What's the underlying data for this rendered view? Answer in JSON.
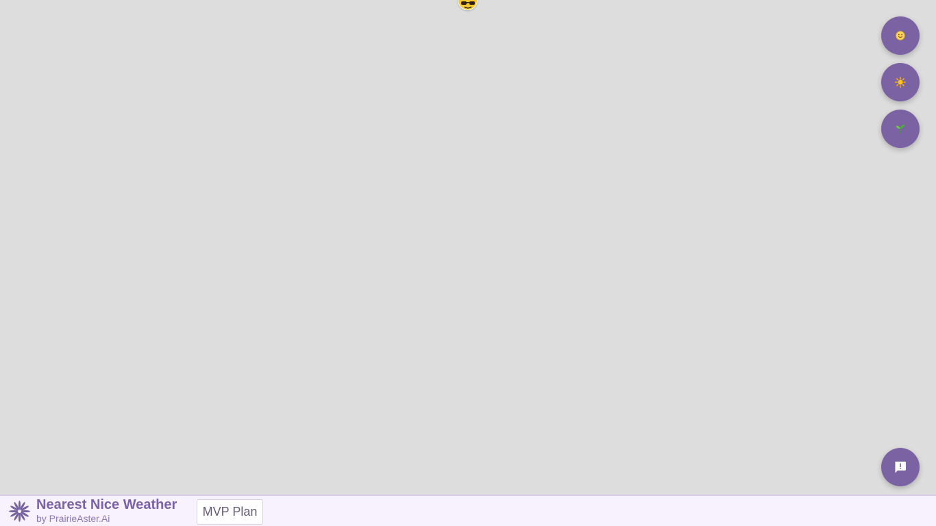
{
  "map": {
    "user_marker_icon": "sunglasses-face-icon"
  },
  "fabs": {
    "mood_icon": "smiling-face-icon",
    "sun_icon": "sun-icon",
    "seedling_icon": "seedling-icon",
    "feedback_icon": "feedback-icon"
  },
  "footer": {
    "title": "Nearest Nice Weather",
    "subtitle": "by PrairieAster.Ai",
    "logo_icon": "aster-flower-icon",
    "mvp_button_label": "MVP Plan"
  },
  "colors": {
    "background": "#dddddd",
    "accent_purple": "#7b62a3",
    "footer_background": "#f7f2fd",
    "title_color": "#7a62a6",
    "marker_yellow": "#f6c730"
  }
}
